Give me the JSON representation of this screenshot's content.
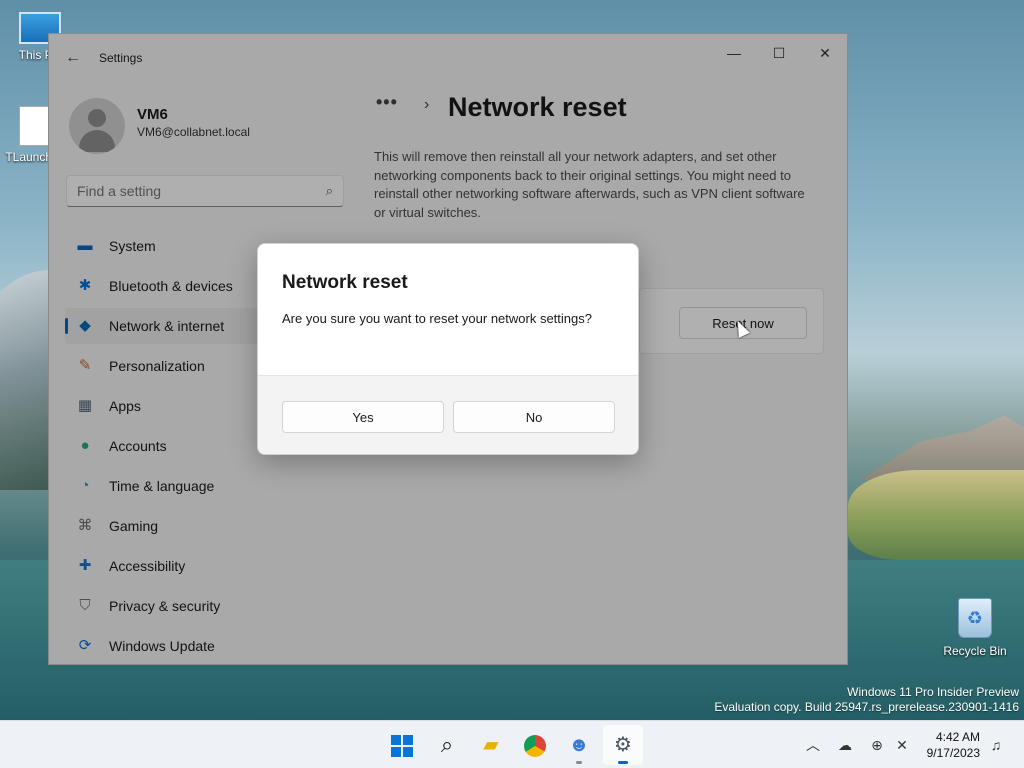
{
  "desktop": {
    "icons": [
      {
        "label": "This PC"
      },
      {
        "label": "TLauncher"
      }
    ],
    "recycle_bin_label": "Recycle Bin",
    "watermark": {
      "line1": "Windows 11 Pro Insider Preview",
      "line2": "Evaluation copy. Build 25947.rs_prerelease.230901-1416"
    }
  },
  "window": {
    "title": "Settings",
    "controls": {
      "minimize": "—",
      "maximize": "☐",
      "close": "✕"
    }
  },
  "user": {
    "name": "VM6",
    "email": "VM6@collabnet.local"
  },
  "search": {
    "placeholder": "Find a setting"
  },
  "sidebar": {
    "items": [
      {
        "label": "System",
        "icon": "system-icon",
        "color": "#0067c0"
      },
      {
        "label": "Bluetooth & devices",
        "icon": "bluetooth-icon",
        "color": "#0a6fd8"
      },
      {
        "label": "Network & internet",
        "icon": "wifi-icon",
        "color": "#0067c0"
      },
      {
        "label": "Personalization",
        "icon": "brush-icon",
        "color": "#c0672d"
      },
      {
        "label": "Apps",
        "icon": "apps-icon",
        "color": "#4c5d6e"
      },
      {
        "label": "Accounts",
        "icon": "person-icon",
        "color": "#2aa676"
      },
      {
        "label": "Time & language",
        "icon": "globe-clock-icon",
        "color": "#2f8fd0"
      },
      {
        "label": "Gaming",
        "icon": "gamepad-icon",
        "color": "#6b6b6b"
      },
      {
        "label": "Accessibility",
        "icon": "accessibility-icon",
        "color": "#1b73c8"
      },
      {
        "label": "Privacy & security",
        "icon": "shield-icon",
        "color": "#6a7077"
      },
      {
        "label": "Windows Update",
        "icon": "update-icon",
        "color": "#0a6fd8"
      }
    ],
    "selected_index": 2
  },
  "main": {
    "breadcrumb_dots": "•••",
    "title": "Network reset",
    "description": "This will remove then reinstall all your network adapters, and set other networking components back to their original settings. You might need to reinstall other networking software afterwards, such as VPN client software or virtual switches.",
    "reset_button": "Reset now"
  },
  "dialog": {
    "title": "Network reset",
    "message": "Are you sure you want to reset your network settings?",
    "yes": "Yes",
    "no": "No"
  },
  "taskbar": {
    "apps": [
      {
        "name": "start-button",
        "icon": "windows-logo-icon"
      },
      {
        "name": "search-button",
        "icon": "search-icon"
      },
      {
        "name": "file-explorer",
        "icon": "folder-icon"
      },
      {
        "name": "chrome",
        "icon": "chrome-icon"
      },
      {
        "name": "communication-app",
        "icon": "people-chat-icon"
      },
      {
        "name": "settings-app",
        "icon": "gear-icon",
        "active": true
      }
    ],
    "time": "4:42 AM",
    "date": "9/17/2023"
  },
  "accent_color": "#0067c0"
}
